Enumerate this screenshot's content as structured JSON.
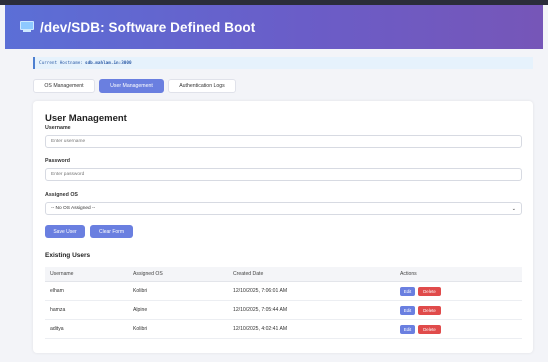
{
  "header": {
    "title": "/dev/SDB: Software Defined Boot",
    "icon": "computer-icon"
  },
  "hostname": {
    "label": "Current Hostname:",
    "value": "sdb.mahlam.in:3000"
  },
  "tabs": [
    {
      "label": "OS Management",
      "active": false
    },
    {
      "label": "User Management",
      "active": true
    },
    {
      "label": "Authentication Logs",
      "active": false
    }
  ],
  "form": {
    "title": "User Management",
    "username": {
      "label": "Username",
      "placeholder": "Enter username"
    },
    "password": {
      "label": "Password",
      "placeholder": "Enter password"
    },
    "assigned_os": {
      "label": "Assigned OS",
      "value": "-- No OS Assigned --"
    },
    "save_label": "Save User",
    "clear_label": "Clear Form"
  },
  "users": {
    "title": "Existing Users",
    "columns": [
      "Username",
      "Assigned OS",
      "Created Date",
      "Actions"
    ],
    "rows": [
      {
        "username": "elham",
        "os": "Kolibri",
        "created": "12/10/2025, 7:06:01 AM"
      },
      {
        "username": "hamza",
        "os": "Alpine",
        "created": "12/10/2025, 7:05:44 AM"
      },
      {
        "username": "aditya",
        "os": "Kolibri",
        "created": "12/10/2025, 4:02:41 AM"
      }
    ],
    "edit_label": "Edit",
    "delete_label": "Delete"
  },
  "colors": {
    "accent": "#6a7fe0",
    "danger": "#e04b4b",
    "header_start": "#5b6fd6",
    "header_end": "#7656b8"
  }
}
